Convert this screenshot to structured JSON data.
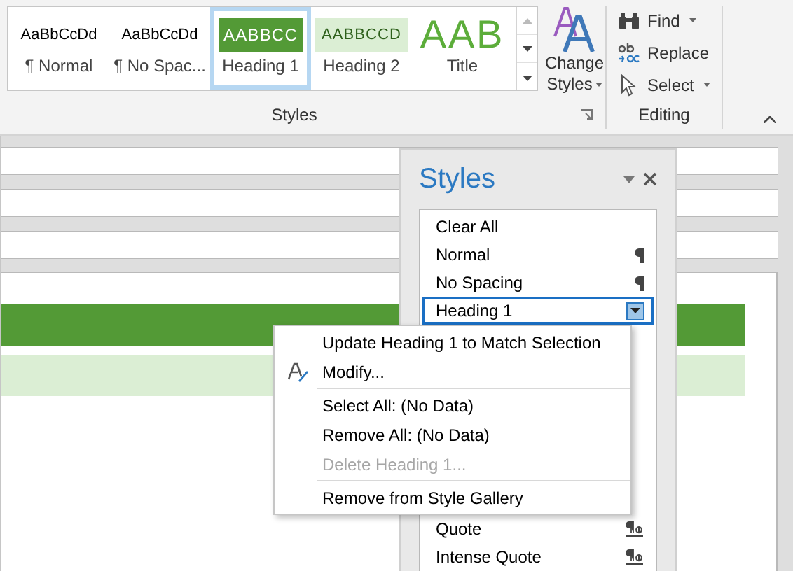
{
  "ribbon": {
    "style_gallery": [
      {
        "preview": "AaBbCcDd",
        "name": "¶ Normal",
        "kind": "body",
        "selected": false
      },
      {
        "preview": "AaBbCcDd",
        "name": "¶ No Spac...",
        "kind": "body",
        "selected": false
      },
      {
        "preview": "AABBCC",
        "name": "Heading 1",
        "kind": "heading1",
        "selected": true
      },
      {
        "preview": "AABBCCD",
        "name": "Heading 2",
        "kind": "heading2",
        "selected": false
      },
      {
        "preview": "AAB",
        "name": "Title",
        "kind": "title",
        "selected": false
      }
    ],
    "change_styles": {
      "line_1": "Change",
      "line_2": "Styles"
    },
    "editing": [
      {
        "label": "Find",
        "kind": "find",
        "has_menu": true
      },
      {
        "label": "Replace",
        "kind": "replace",
        "has_menu": false
      },
      {
        "label": "Select",
        "kind": "select",
        "has_menu": true
      }
    ],
    "group_labels": [
      "Styles",
      "Editing"
    ]
  },
  "styles_pane": {
    "title": "Styles",
    "items": [
      {
        "name": "Clear All",
        "kind": "none",
        "selected": false
      },
      {
        "name": "Normal",
        "kind": "paragraph",
        "selected": false
      },
      {
        "name": "No Spacing",
        "kind": "paragraph",
        "selected": false
      },
      {
        "name": "Heading 1",
        "selected": true
      }
    ],
    "items_below_menu": [
      {
        "name": "Quote",
        "kind": "linked",
        "selected": false
      },
      {
        "name": "Intense Quote",
        "kind": "linked",
        "selected": false
      }
    ]
  },
  "context_menu": [
    {
      "kind": "plain",
      "label": "Update Heading 1 to Match Selection",
      "disabled": false
    },
    {
      "kind": "with-icon",
      "label": "Modify...",
      "disabled": false
    },
    {
      "kind": "separator"
    },
    {
      "kind": "plain",
      "label": "Select All: (No Data)",
      "disabled": false
    },
    {
      "kind": "plain",
      "label": "Remove All: (No Data)",
      "disabled": false
    },
    {
      "kind": "plain",
      "label": "Delete Heading 1...",
      "disabled": true
    },
    {
      "kind": "separator"
    },
    {
      "kind": "plain",
      "label": "Remove from Style Gallery",
      "disabled": false
    }
  ]
}
